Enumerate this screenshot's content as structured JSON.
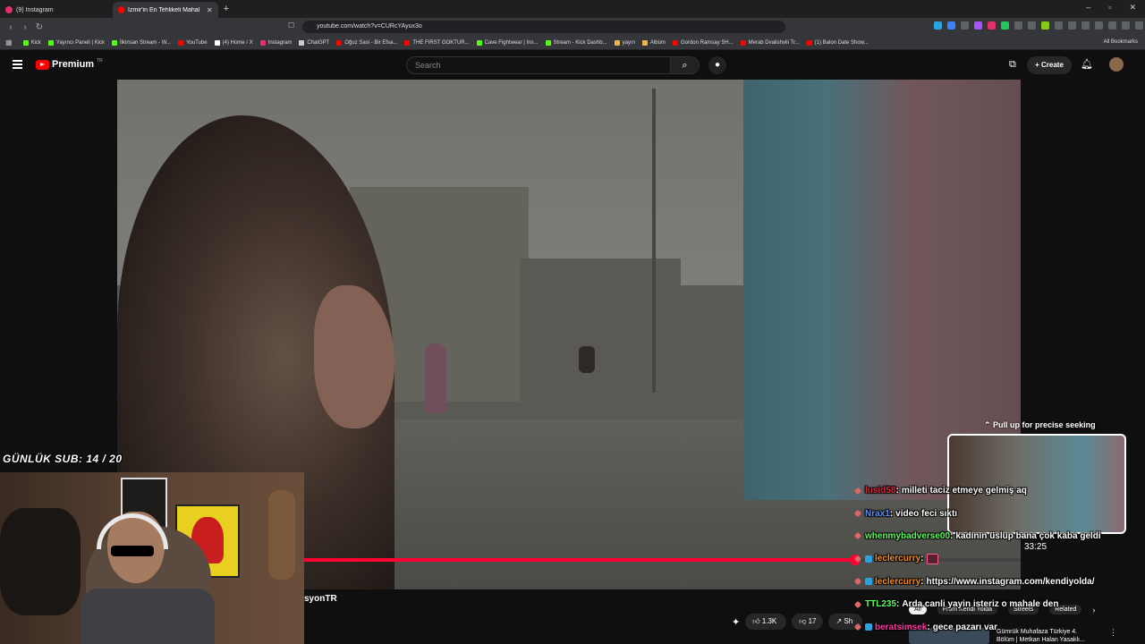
{
  "browser": {
    "tabs": [
      {
        "label": "(9) Instagram",
        "active": false
      },
      {
        "label": "İzmir'in En Tehlikeli Mahallesine",
        "active": true
      }
    ],
    "url": "youtube.com/watch?v=CURcYAyux3o",
    "bookmarks": [
      {
        "label": "Kick",
        "color": "#53fc18"
      },
      {
        "label": "Yayıncı Paneli | Kick",
        "color": "#53fc18"
      },
      {
        "label": "İlkinsan Stream - W...",
        "color": "#53fc18"
      },
      {
        "label": "YouTube",
        "color": "#ff0000"
      },
      {
        "label": "(4) Home / X",
        "color": "#ffffff"
      },
      {
        "label": "Instagram",
        "color": "#e1306c"
      },
      {
        "label": "ChatGPT",
        "color": "#cccccc"
      },
      {
        "label": "Oğuz Sasi - Bir Efsa...",
        "color": "#ff0000"
      },
      {
        "label": "THE FIRST GOKTUR...",
        "color": "#ff0000"
      },
      {
        "label": "Cave Fightwear | Ins...",
        "color": "#53fc18"
      },
      {
        "label": "Stream - Kick Dashb...",
        "color": "#53fc18"
      },
      {
        "label": "yayın",
        "color": "#e8b84a"
      },
      {
        "label": "Albüm",
        "color": "#e8b84a"
      },
      {
        "label": "Gordon Ramsay SH...",
        "color": "#ff0000"
      },
      {
        "label": "Merab Dvalishvili Tr...",
        "color": "#ff0000"
      },
      {
        "label": "(1) Balon Date Show...",
        "color": "#ff0000"
      }
    ],
    "all_bookmarks": "All Bookmarks"
  },
  "youtube": {
    "logo": "Premium",
    "region": "TR",
    "search_placeholder": "Search",
    "create_label": "Create",
    "pull_up": "Pull up for precise seeking",
    "preview_time": "33:25",
    "channel_partial": "syonTR",
    "likes": "1.3K",
    "dislikes": "17",
    "share_partial": "Sh",
    "rec_chips": [
      "All",
      "From Kendi Yolda",
      "Streets",
      "Related"
    ],
    "rec_title": "Gümrük Muhafaza Türkiye 4. Bölüm | Metkan Halan Yasaklı...",
    "progress_percent": 81.7,
    "accent": "#ff0033"
  },
  "stream": {
    "sub_goal": "GÜNLÜK SUB: 14 / 20"
  },
  "chat": [
    {
      "user": "lusid58",
      "color": "#e0243a",
      "badge": "pick",
      "message": "milleti taciz etmeye gelmiş aq"
    },
    {
      "user": "Nrax1",
      "color": "#5b8fff",
      "badge": "pick",
      "message": "video feci sıktı"
    },
    {
      "user": "whenmybadverse00",
      "color": "#5cff5c",
      "badge": "pick",
      "message": "kadının üslup bana çok kaba geldi"
    },
    {
      "user": "leclercurry",
      "color": "#ff8c1a",
      "badge": "pick+cube",
      "message": "",
      "emote": true
    },
    {
      "user": "leclercurry",
      "color": "#ff8c1a",
      "badge": "pick+cube",
      "message": "https://www.instagram.com/kendiyolda/"
    },
    {
      "user": "TTL235",
      "color": "#5cff5c",
      "badge": "pick",
      "message": "Arda canli yayin isteriz o mahale den"
    },
    {
      "user": "beratsimsek",
      "color": "#ff3aa0",
      "badge": "pick+cube",
      "message": "gece pazarı var"
    }
  ]
}
